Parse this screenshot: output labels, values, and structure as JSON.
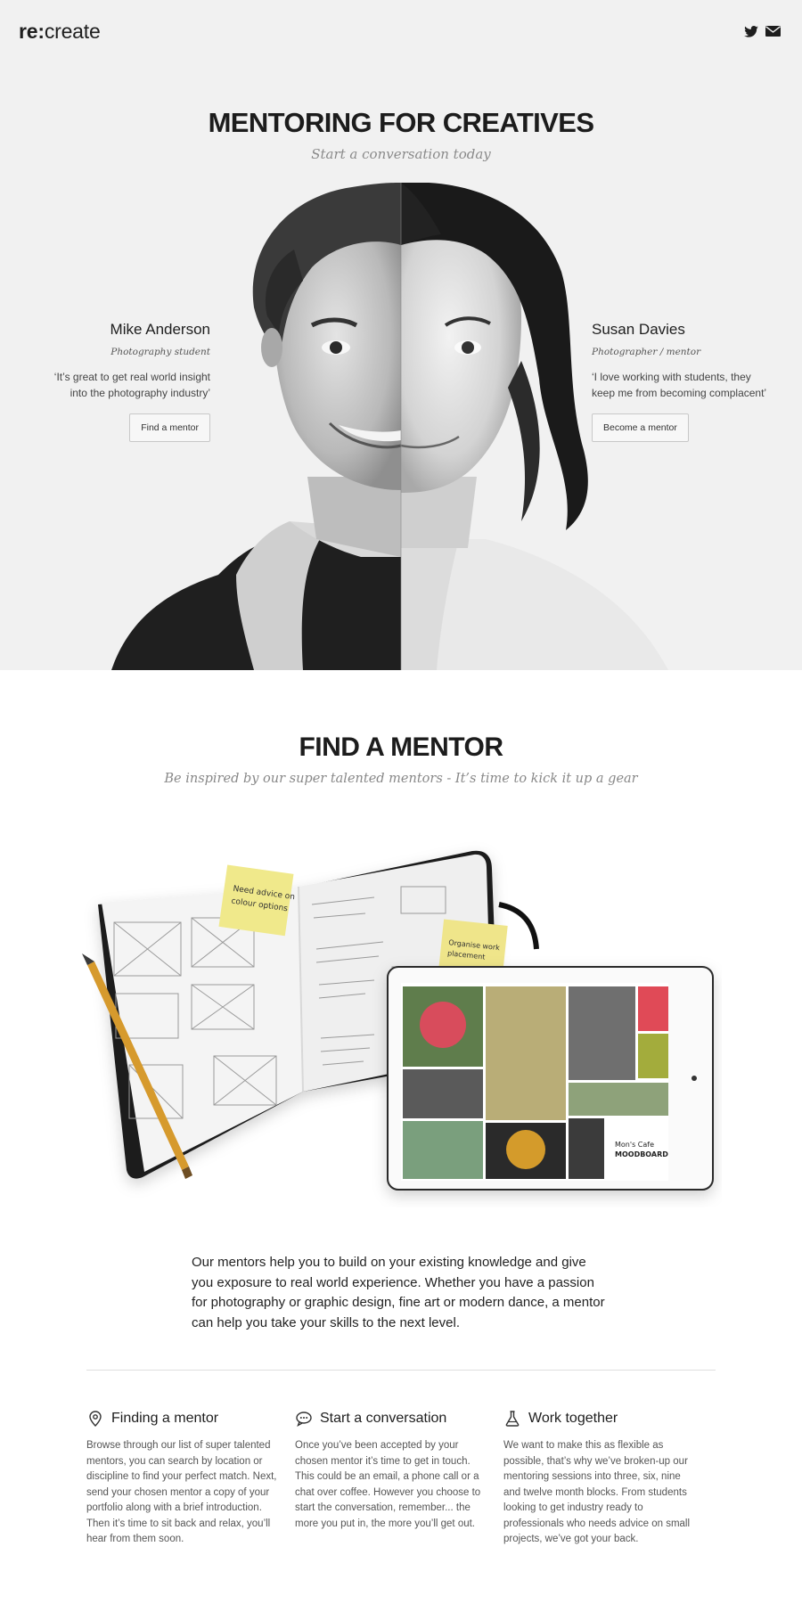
{
  "header": {
    "logo_bold": "re:",
    "logo_rest": "create",
    "icons": [
      "twitter-icon",
      "mail-icon"
    ]
  },
  "hero": {
    "title": "MENTORING FOR CREATIVES",
    "subtitle": "Start a conversation today",
    "left": {
      "name": "Mike Anderson",
      "role": "Photography student",
      "quote": "‘It’s great to get real world insight into the photography industry’",
      "button": "Find a mentor"
    },
    "right": {
      "name": "Susan Davies",
      "role": "Photographer / mentor",
      "quote": "‘I love working with students, they keep me from becoming complacent’",
      "button": "Become a mentor"
    }
  },
  "find_mentor": {
    "title": "FIND A MENTOR",
    "subtitle": "Be inspired by our super talented mentors - It’s time to kick it up a gear",
    "sticky_note_1": "Need advice on colour options",
    "sticky_note_2": "Organise work placement",
    "moodboard_label": "Mon's Cafe MOODBOARD",
    "intro": "Our mentors help you to build on your existing knowledge and give you exposure to real world experience. Whether you have a passion for photography or graphic design, fine art or modern dance, a mentor can help you take your skills to the next level."
  },
  "features": [
    {
      "icon": "map-pin-icon",
      "title": "Finding a mentor",
      "body": "Browse through our list of super talented mentors, you can search by location or discipline to find your perfect match. Next, send your chosen mentor a copy of your portfolio along with a brief introduction. Then it’s time to sit back and relax, you’ll hear from them soon."
    },
    {
      "icon": "speech-bubble-icon",
      "title": "Start a conversation",
      "body": "Once you’ve been accepted by your chosen mentor it’s time to get in touch. This could be an email, a phone call or a chat over coffee. However you choose to start the conversation, remember... the more you put in, the more you’ll get out."
    },
    {
      "icon": "flask-icon",
      "title": "Work together",
      "body": "We want to make this as flexible as possible, that’s why we’ve broken-up our mentoring sessions into three, six, nine and twelve month blocks. From students looking to get industry ready to professionals who needs advice on small projects, we’ve got your back."
    }
  ],
  "colors": {
    "hero_bg": "#f1f1f1",
    "text_dark": "#1e1e1e",
    "subtitle_gray": "#8a8a8a",
    "moodboard_red": "#e04a57",
    "moodboard_olive": "#a3ac3c",
    "moodboard_sage": "#7a9f7d"
  }
}
